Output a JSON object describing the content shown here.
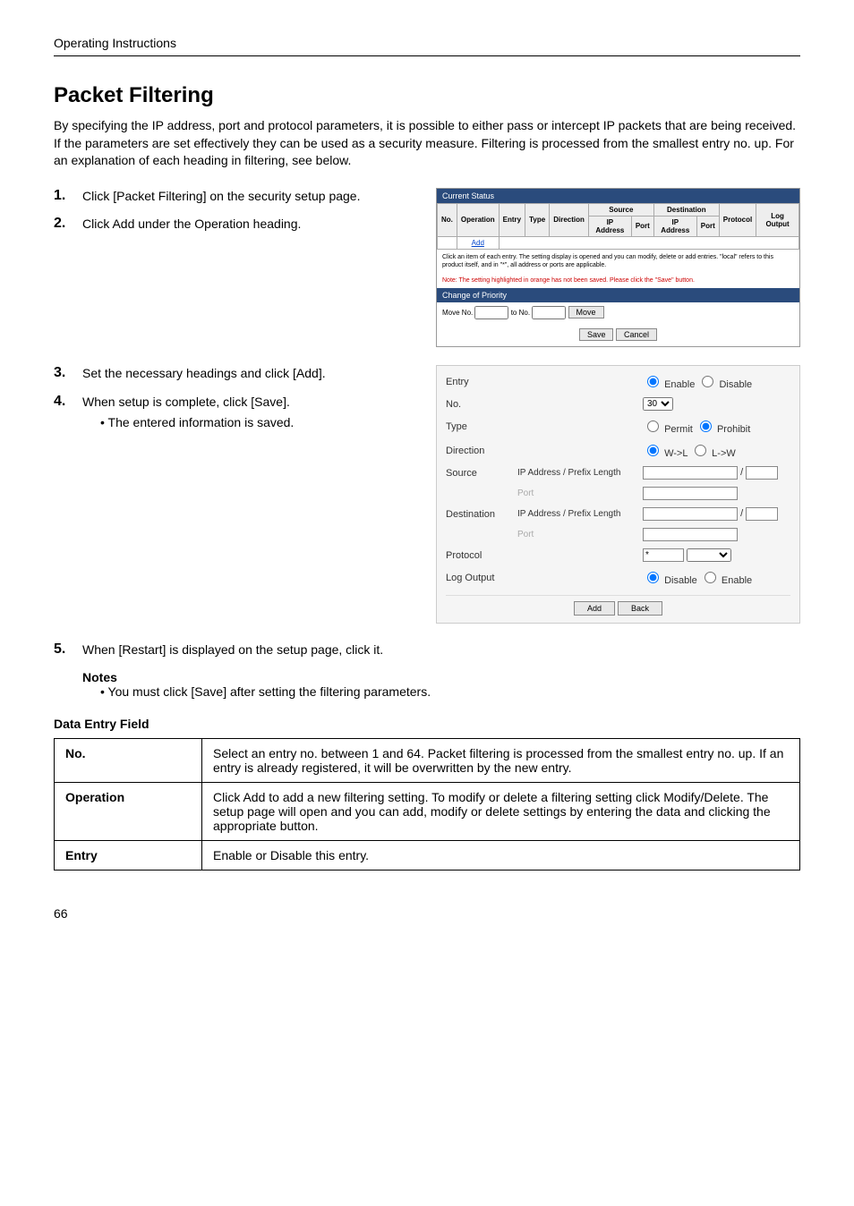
{
  "header": "Operating Instructions",
  "title": "Packet Filtering",
  "intro": "By specifying the IP address, port and protocol parameters, it is possible to either pass or intercept IP packets that are being received. If the parameters are set effectively they can be used as a security measure. Filtering is processed from the smallest entry no. up. For an explanation of each heading in filtering, see below.",
  "steps": {
    "s1_num": "1.",
    "s1_text": "Click [Packet Filtering] on the security setup page.",
    "s2_num": "2.",
    "s2_text": "Click Add under the Operation heading.",
    "s3_num": "3.",
    "s3_text": "Set the necessary headings and click [Add].",
    "s4_num": "4.",
    "s4_text": "When setup is complete, click [Save].",
    "s4_bullet": "The entered information is saved.",
    "s5_num": "5.",
    "s5_text": "When [Restart] is displayed on the setup page, click it."
  },
  "notes_heading": "Notes",
  "notes_bullet": "You must click [Save] after setting the filtering parameters.",
  "ss1": {
    "bar1": "Current Status",
    "th_no": "No.",
    "th_op": "Operation",
    "th_entry": "Entry",
    "th_type": "Type",
    "th_dir": "Direction",
    "th_src": "Source",
    "th_dst": "Destination",
    "th_proto": "Protocol",
    "th_log": "Log Output",
    "th_ip": "IP Address",
    "th_port": "Port",
    "add_link": "Add",
    "note1": "Click an item of each entry. The setting display is opened and you can modify, delete or add entries. \"local\" refers to this product itself, and in \"*\", all address or ports are applicable.",
    "note2": "Note: The setting highlighted in orange has not been saved. Please click the \"Save\" button.",
    "bar2": "Change of Priority",
    "move_no": "Move No.",
    "to_no": "to No.",
    "btn_move": "Move",
    "btn_save": "Save",
    "btn_cancel": "Cancel"
  },
  "ss2": {
    "entry_label": "Entry",
    "entry_enable": "Enable",
    "entry_disable": "Disable",
    "no_label": "No.",
    "no_value": "30",
    "type_label": "Type",
    "type_permit": "Permit",
    "type_prohibit": "Prohibit",
    "dir_label": "Direction",
    "dir_wl": "W->L",
    "dir_lw": "L->W",
    "src_label": "Source",
    "ip_prefix": "IP Address / Prefix Length",
    "port_label": "Port",
    "dst_label": "Destination",
    "proto_label": "Protocol",
    "proto_value": "*",
    "log_label": "Log Output",
    "log_disable": "Disable",
    "log_enable": "Enable",
    "btn_add": "Add",
    "btn_back": "Back",
    "slash": "/"
  },
  "data_entry_heading": "Data Entry Field",
  "table_rows": {
    "r1_h": "No.",
    "r1_d": "Select an entry no. between 1 and 64. Packet filtering is processed from the smallest entry no. up. If an entry is already registered, it will be overwritten by the new entry.",
    "r2_h": "Operation",
    "r2_d": "Click Add to add a new filtering setting. To modify or delete a filtering setting click Modify/Delete. The setup page will open and you can add, modify or delete settings by entering the data and clicking the appropriate button.",
    "r3_h": "Entry",
    "r3_d": "Enable or Disable this entry."
  },
  "page_number": "66"
}
